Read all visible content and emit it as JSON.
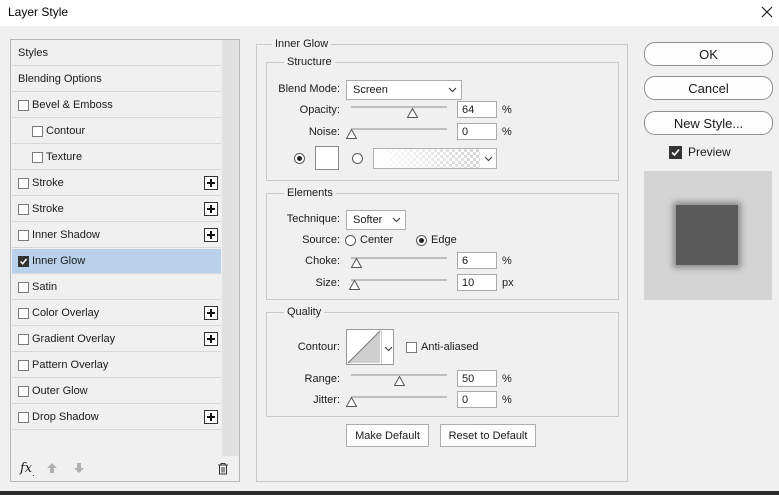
{
  "window": {
    "title": "Layer Style"
  },
  "styles_list": {
    "items": [
      {
        "label": "Styles",
        "checkbox": false,
        "checked": false,
        "plus": false,
        "indent": 0,
        "selected": false
      },
      {
        "label": "Blending Options",
        "checkbox": false,
        "checked": false,
        "plus": false,
        "indent": 0,
        "selected": false
      },
      {
        "label": "Bevel & Emboss",
        "checkbox": true,
        "checked": false,
        "plus": false,
        "indent": 0,
        "selected": false
      },
      {
        "label": "Contour",
        "checkbox": true,
        "checked": false,
        "plus": false,
        "indent": 1,
        "selected": false
      },
      {
        "label": "Texture",
        "checkbox": true,
        "checked": false,
        "plus": false,
        "indent": 1,
        "selected": false
      },
      {
        "label": "Stroke",
        "checkbox": true,
        "checked": false,
        "plus": true,
        "indent": 0,
        "selected": false
      },
      {
        "label": "Stroke",
        "checkbox": true,
        "checked": false,
        "plus": true,
        "indent": 0,
        "selected": false
      },
      {
        "label": "Inner Shadow",
        "checkbox": true,
        "checked": false,
        "plus": true,
        "indent": 0,
        "selected": false
      },
      {
        "label": "Inner Glow",
        "checkbox": true,
        "checked": true,
        "plus": false,
        "indent": 0,
        "selected": true
      },
      {
        "label": "Satin",
        "checkbox": true,
        "checked": false,
        "plus": false,
        "indent": 0,
        "selected": false
      },
      {
        "label": "Color Overlay",
        "checkbox": true,
        "checked": false,
        "plus": true,
        "indent": 0,
        "selected": false
      },
      {
        "label": "Gradient Overlay",
        "checkbox": true,
        "checked": false,
        "plus": true,
        "indent": 0,
        "selected": false
      },
      {
        "label": "Pattern Overlay",
        "checkbox": true,
        "checked": false,
        "plus": false,
        "indent": 0,
        "selected": false
      },
      {
        "label": "Outer Glow",
        "checkbox": true,
        "checked": false,
        "plus": false,
        "indent": 0,
        "selected": false
      },
      {
        "label": "Drop Shadow",
        "checkbox": true,
        "checked": false,
        "plus": true,
        "indent": 0,
        "selected": false
      }
    ],
    "footer": {
      "fx_label": "fx"
    }
  },
  "inner_glow": {
    "section_title": "Inner Glow",
    "structure": {
      "title": "Structure",
      "blend_mode_label": "Blend Mode:",
      "blend_mode_value": "Screen",
      "opacity_label": "Opacity:",
      "opacity_value": "64",
      "opacity_unit": "%",
      "opacity_level": 0.64,
      "noise_label": "Noise:",
      "noise_value": "0",
      "noise_unit": "%",
      "noise_level": 0,
      "color_swatch": "#ffffff"
    },
    "elements": {
      "title": "Elements",
      "technique_label": "Technique:",
      "technique_value": "Softer",
      "source_label": "Source:",
      "source_center": "Center",
      "source_edge": "Edge",
      "choke_label": "Choke:",
      "choke_value": "6",
      "choke_unit": "%",
      "choke_level": 0.06,
      "size_label": "Size:",
      "size_value": "10",
      "size_unit": "px",
      "size_level": 0.04
    },
    "quality": {
      "title": "Quality",
      "contour_label": "Contour:",
      "anti_aliased_label": "Anti-aliased",
      "range_label": "Range:",
      "range_value": "50",
      "range_unit": "%",
      "range_level": 0.5,
      "jitter_label": "Jitter:",
      "jitter_value": "0",
      "jitter_unit": "%",
      "jitter_level": 0
    },
    "buttons": {
      "make_default": "Make Default",
      "reset_default": "Reset to Default"
    }
  },
  "actions": {
    "ok": "OK",
    "cancel": "Cancel",
    "new_style": "New Style...",
    "preview_label": "Preview",
    "preview_checked": true
  },
  "colors": {
    "selection": "#b9d1ea",
    "window_bg": "#f0f0f0",
    "preview_bg": "#d4d4d4",
    "preview_square": "#5a5a5a"
  }
}
